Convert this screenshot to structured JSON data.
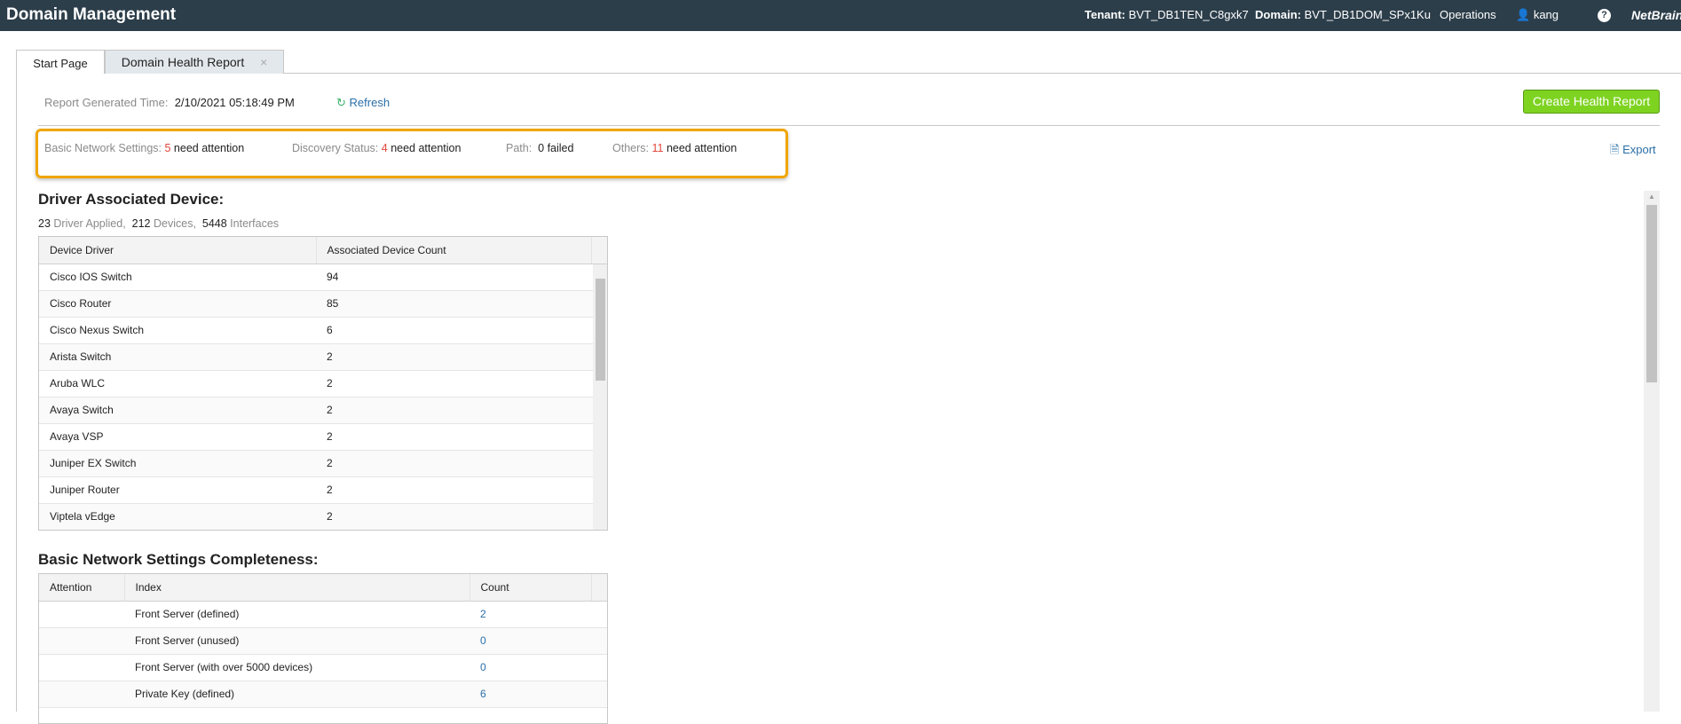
{
  "header": {
    "title": "Domain Management",
    "tenant_label": "Tenant:",
    "tenant": "BVT_DB1TEN_C8gxk7",
    "domain_label": "Domain:",
    "domain": "BVT_DB1DOM_SPx1Ku",
    "operations": "Operations",
    "user": "kang",
    "logo": "NetBrain"
  },
  "tabs": [
    {
      "label": "Start Page"
    },
    {
      "label": "Domain Health Report"
    }
  ],
  "report": {
    "time_label": "Report Generated Time:",
    "time": "2/10/2021 05:18:49 PM",
    "refresh": "Refresh",
    "create_button": "Create Health Report",
    "export": "Export"
  },
  "summary": [
    {
      "label": "Basic Network Settings:",
      "count": "5",
      "text": "need attention"
    },
    {
      "label": "Discovery Status:",
      "count": "4",
      "text": "need attention"
    },
    {
      "label": "Path:",
      "count": "0",
      "text": "failed"
    },
    {
      "label": "Others:",
      "count": "11",
      "text": "need attention"
    }
  ],
  "driver": {
    "title": "Driver Associated Device:",
    "drivers_count": "23",
    "drivers_label": "Driver Applied,",
    "devices_count": "212",
    "devices_label": "Devices,",
    "interfaces_count": "5448",
    "interfaces_label": "Interfaces",
    "columns": [
      "Device Driver",
      "Associated Device Count"
    ],
    "rows": [
      [
        "Cisco IOS Switch",
        "94"
      ],
      [
        "Cisco Router",
        "85"
      ],
      [
        "Cisco Nexus Switch",
        "6"
      ],
      [
        "Arista Switch",
        "2"
      ],
      [
        "Aruba WLC",
        "2"
      ],
      [
        "Avaya Switch",
        "2"
      ],
      [
        "Avaya VSP",
        "2"
      ],
      [
        "Juniper EX Switch",
        "2"
      ],
      [
        "Juniper Router",
        "2"
      ],
      [
        "Viptela vEdge",
        "2"
      ]
    ]
  },
  "basic": {
    "title": "Basic Network Settings Completeness:",
    "columns": [
      "Attention",
      "Index",
      "Count"
    ],
    "rows": [
      [
        "",
        "Front Server (defined)",
        "2"
      ],
      [
        "",
        "Front Server (unused)",
        "0"
      ],
      [
        "",
        "Front Server (with over 5000 devices)",
        "0"
      ],
      [
        "",
        "Private Key (defined)",
        "6"
      ],
      [
        "",
        "",
        ""
      ]
    ]
  }
}
